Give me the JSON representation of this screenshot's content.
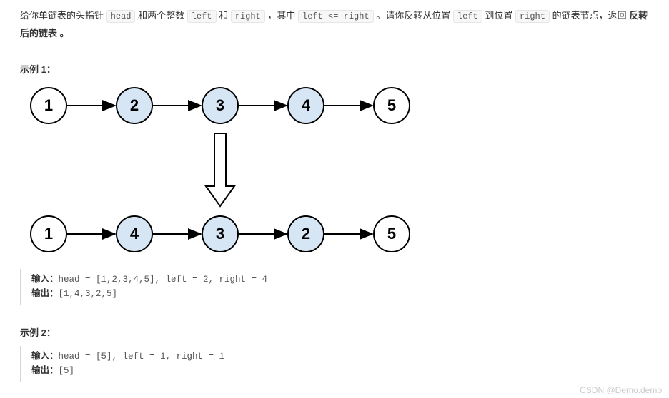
{
  "desc": {
    "p1": "给你单链表的头指针 ",
    "c1": "head",
    "p2": " 和两个整数 ",
    "c2": "left",
    "p3": " 和 ",
    "c3": "right",
    "p4": " ，其中 ",
    "c4": "left <= right",
    "p5": " 。请你反转从位置 ",
    "c5": "left",
    "p6": " 到位置 ",
    "c6": "right",
    "p7": " 的链表节点，返回 ",
    "bold1": "反转后的链表 。"
  },
  "example1": {
    "title": "示例 1：",
    "input_label": "输入：",
    "input_value": "head = [1,2,3,4,5], left = 2, right = 4",
    "output_label": "输出：",
    "output_value": "[1,4,3,2,5]"
  },
  "example2": {
    "title": "示例 2：",
    "input_label": "输入：",
    "input_value": "head = [5], left = 1, right = 1",
    "output_label": "输出：",
    "output_value": "[5]"
  },
  "diagram": {
    "top_nodes": [
      "1",
      "2",
      "3",
      "4",
      "5"
    ],
    "top_highlight": [
      false,
      true,
      true,
      true,
      false
    ],
    "bottom_nodes": [
      "1",
      "4",
      "3",
      "2",
      "5"
    ],
    "bottom_highlight": [
      false,
      true,
      true,
      true,
      false
    ]
  },
  "watermark": "CSDN @Demo.demo"
}
